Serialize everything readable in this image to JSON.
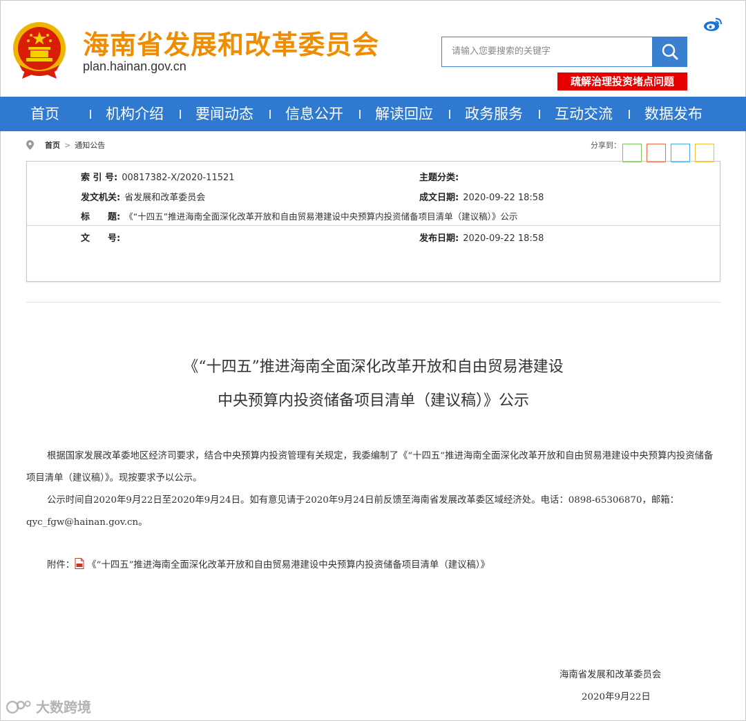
{
  "header": {
    "site_title": "海南省发展和改革委员会",
    "site_domain": "plan.hainan.gov.cn",
    "search_placeholder": "请输入您要搜索的关键字",
    "promo_banner": "疏解治理投资堵点问题",
    "brand_color": "#f08c00",
    "nav_color": "#2f79d1"
  },
  "nav": {
    "items": [
      "首页",
      "机构介绍",
      "要闻动态",
      "信息公开",
      "解读回应",
      "政务服务",
      "互动交流",
      "数据发布"
    ]
  },
  "breadcrumb": {
    "home": "首页",
    "separator": ">",
    "current": "通知公告"
  },
  "share": {
    "label": "分享到："
  },
  "meta": {
    "index_label": "索 引 号:",
    "index_value": "00817382-X/2020-11521",
    "topic_label": "主题分类:",
    "topic_value": "",
    "issuer_label": "发文机关:",
    "issuer_value": "省发展和改革委员会",
    "created_label": "成文日期:",
    "created_value": "2020-09-22 18:58",
    "title_label": "标　　题:",
    "title_value": "《“十四五”推进海南全面深化改革开放和自由贸易港建设中央预算内投资储备项目清单（建议稿）》公示",
    "docno_label": "文　　号:",
    "docno_value": "",
    "published_label": "发布日期:",
    "published_value": "2020-09-22 18:58"
  },
  "article": {
    "title_line1": "《“十四五”推进海南全面深化改革开放和自由贸易港建设",
    "title_line2": "中央预算内投资储备项目清单（建议稿）》公示",
    "para1": "根据国家发展改革委地区经济司要求，结合中央预算内投资管理有关规定，我委编制了《“十四五”推进海南全面深化改革开放和自由贸易港建设中央预算内投资储备项目清单（建议稿）》。现按要求予以公示。",
    "para2": "公示时间自2020年9月22日至2020年9月24日。如有意见请于2020年9月24日前反馈至海南省发展改革委区域经济处。电话：0898-65306870，邮箱：qyc_fgw@hainan.gov.cn。",
    "attachment_label": "附件：",
    "attachment_link": "《“十四五”推进海南全面深化改革开放和自由贸易港建设中央预算内投资储备项目清单（建议稿）》",
    "sign_org": "海南省发展和改革委员会",
    "sign_date": "2020年9月22日"
  },
  "watermark": {
    "text": "大数跨境"
  }
}
